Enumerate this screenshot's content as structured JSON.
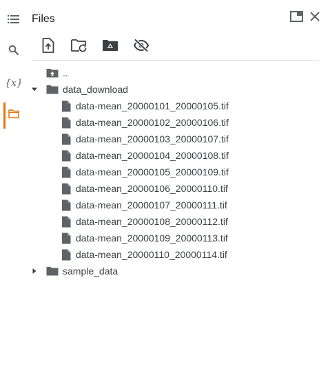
{
  "header": {
    "title": "Files"
  },
  "rail": {
    "items": [
      {
        "icon": "table-of-contents-icon"
      },
      {
        "icon": "search-icon"
      },
      {
        "icon": "variables-icon",
        "glyph": "{x}"
      },
      {
        "icon": "folder-icon",
        "active": true
      }
    ],
    "active_color": "#e8710a"
  },
  "toolbar": {
    "buttons": [
      {
        "icon": "upload-file-icon"
      },
      {
        "icon": "refresh-folder-icon"
      },
      {
        "icon": "mount-drive-icon"
      },
      {
        "icon": "hide-files-icon"
      }
    ]
  },
  "tree": {
    "parent": {
      "label": ".."
    },
    "folders": [
      {
        "label": "data_download",
        "expanded": true,
        "files": [
          "data-mean_20000101_20000105.tif",
          "data-mean_20000102_20000106.tif",
          "data-mean_20000103_20000107.tif",
          "data-mean_20000104_20000108.tif",
          "data-mean_20000105_20000109.tif",
          "data-mean_20000106_20000110.tif",
          "data-mean_20000107_20000111.tif",
          "data-mean_20000108_20000112.tif",
          "data-mean_20000109_20000113.tif",
          "data-mean_20000110_20000114.tif"
        ]
      },
      {
        "label": "sample_data",
        "expanded": false,
        "files": []
      }
    ]
  }
}
